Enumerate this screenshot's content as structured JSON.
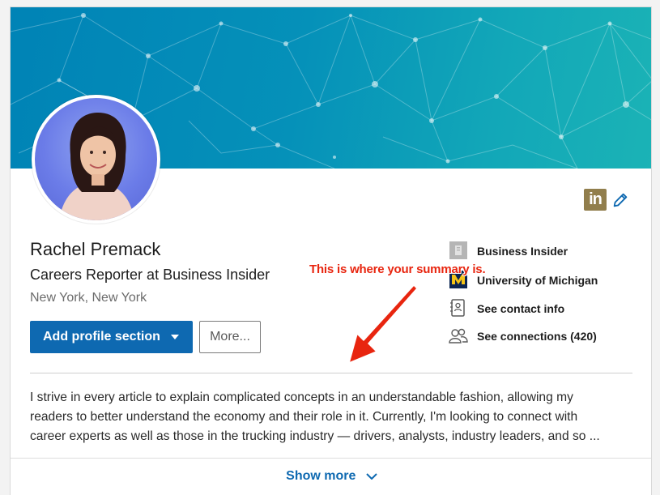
{
  "profile": {
    "name": "Rachel Premack",
    "headline": "Careers Reporter at Business Insider",
    "location": "New York, New York"
  },
  "actions": {
    "add_section_label": "Add profile section",
    "more_label": "More..."
  },
  "top_icons": {
    "linkedin_badge_text": "in"
  },
  "sidebar": {
    "items": [
      {
        "label": "Business Insider",
        "icon": "company-logo-icon"
      },
      {
        "label": "University of Michigan",
        "icon": "school-logo-icon"
      },
      {
        "label": "See contact info",
        "icon": "contact-card-icon"
      },
      {
        "label": "See connections (420)",
        "icon": "people-icon"
      }
    ]
  },
  "summary": {
    "lines": [
      "I strive in every article to explain complicated concepts in an understandable fashion, allowing my",
      "readers to better understand the economy and their role in it. Currently, I'm looking to connect with",
      "career experts as well as those in the trucking industry — drivers, analysts, industry leaders, and so ..."
    ],
    "show_more_label": "Show more"
  },
  "annotation": {
    "text": "This is where your summary is."
  },
  "colors": {
    "brand_blue": "#0e69b1",
    "banner_start": "#0083b6",
    "banner_end": "#1bb3b6",
    "annotation_red": "#e8250f",
    "linkedin_badge": "#917e4c"
  }
}
